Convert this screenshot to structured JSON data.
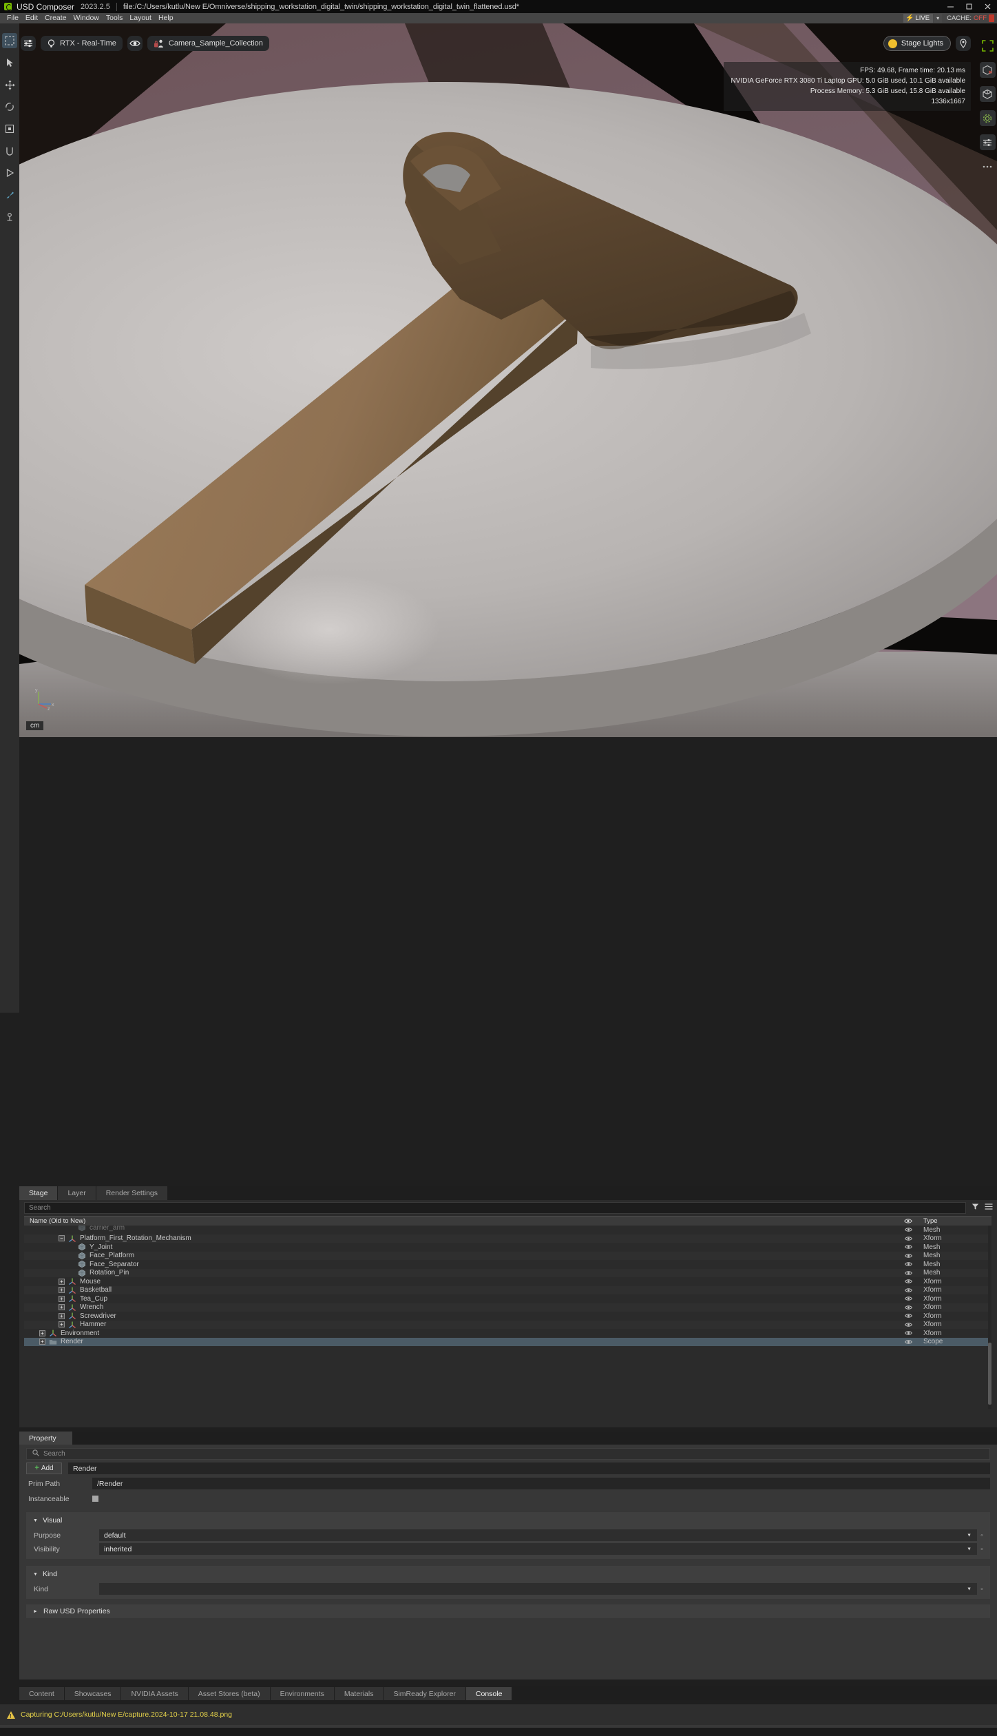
{
  "titlebar": {
    "app_name": "USD Composer",
    "version": "2023.2.5",
    "file_path": "file:/C:/Users/kutlu/New E/Omniverse/shipping_workstation_digital_twin/shipping_workstation_digital_twin_flattened.usd*",
    "minimize": "—",
    "maximize": "□",
    "close": "✕"
  },
  "menubar": {
    "items": [
      "File",
      "Edit",
      "Create",
      "Window",
      "Tools",
      "Layout",
      "Help"
    ]
  },
  "live_strip": {
    "live_label": "LIVE",
    "bolt": "⚡",
    "caret": "▾",
    "cache_label": "CACHE:",
    "cache_value": "OFF"
  },
  "left_toolbar": {
    "items": [
      {
        "name": "select-mode-icon",
        "selected": true
      },
      {
        "name": "cursor-select-icon",
        "selected": false
      },
      {
        "name": "move-tool-icon",
        "selected": false
      },
      {
        "name": "rotate-tool-icon",
        "selected": false
      },
      {
        "name": "scale-tool-icon",
        "selected": false
      },
      {
        "name": "snap-tool-icon",
        "selected": false
      },
      {
        "name": "play-animation-icon",
        "selected": false
      },
      {
        "name": "paint-tool-icon",
        "selected": false
      },
      {
        "name": "physics-tool-icon",
        "selected": false
      }
    ]
  },
  "viewport_toolbar": {
    "settings_icon": "sliders-icon",
    "renderer_label": "RTX - Real-Time",
    "renderer_icon": "lightbulb-icon",
    "eye_icon": "eye-icon",
    "camera_label": "Camera_Sample_Collection",
    "camera_icon": "camera-lock-icon",
    "stage_lights_label": "Stage Lights",
    "stage_lights_icon": "lightbulb-filled-icon",
    "pin_icon": "location-pin-icon"
  },
  "hud": {
    "line1": "FPS: 49.68, Frame time: 20.13 ms",
    "line2": "NVIDIA GeForce RTX 3080 Ti Laptop GPU: 5.0 GiB used, 10.1 GiB available",
    "line3": "Process Memory: 5.3 GiB used, 15.8 GiB available",
    "line4": "1336x1667"
  },
  "viewport": {
    "unit_badge": "cm",
    "axis_x_label": "x",
    "axis_y_label": "y",
    "axis_z_label": "z"
  },
  "right_toolbar": {
    "items": [
      {
        "name": "viewport-expand-icon"
      },
      {
        "name": "cube-delete-icon"
      },
      {
        "name": "cube-add-icon"
      },
      {
        "name": "settings-gear-icon"
      },
      {
        "name": "sliders-adjust-icon"
      },
      {
        "name": "options-dots-icon"
      }
    ]
  },
  "stage_panel": {
    "tabs": [
      {
        "label": "Stage",
        "active": true
      },
      {
        "label": "Layer",
        "active": false
      },
      {
        "label": "Render Settings",
        "active": false
      }
    ],
    "search_placeholder": "Search",
    "filter_icon": "funnel-icon",
    "options_icon": "hamburger-icon",
    "columns": {
      "name": "Name (Old to New)",
      "eye": "",
      "type": "Type"
    },
    "rows": [
      {
        "label": "carrier_arm",
        "type": "Mesh",
        "indent": 4,
        "icon": "mesh",
        "expander": "none",
        "clipped": true,
        "selected": false
      },
      {
        "label": "Platform_First_Rotation_Mechanism",
        "type": "Xform",
        "indent": 3,
        "icon": "xform",
        "expander": "minus",
        "selected": false
      },
      {
        "label": "Y_Joint",
        "type": "Mesh",
        "indent": 4,
        "icon": "mesh",
        "expander": "none",
        "selected": false
      },
      {
        "label": "Face_Platform",
        "type": "Mesh",
        "indent": 4,
        "icon": "mesh",
        "expander": "none",
        "selected": false
      },
      {
        "label": "Face_Separator",
        "type": "Mesh",
        "indent": 4,
        "icon": "mesh",
        "expander": "none",
        "selected": false
      },
      {
        "label": "Rotation_Pin",
        "type": "Mesh",
        "indent": 4,
        "icon": "mesh",
        "expander": "none",
        "selected": false
      },
      {
        "label": "Mouse",
        "type": "Xform",
        "indent": 3,
        "icon": "xform",
        "expander": "plus",
        "selected": false
      },
      {
        "label": "Basketball",
        "type": "Xform",
        "indent": 3,
        "icon": "xform",
        "expander": "plus",
        "selected": false
      },
      {
        "label": "Tea_Cup",
        "type": "Xform",
        "indent": 3,
        "icon": "xform",
        "expander": "plus",
        "selected": false
      },
      {
        "label": "Wrench",
        "type": "Xform",
        "indent": 3,
        "icon": "xform",
        "expander": "plus",
        "selected": false
      },
      {
        "label": "Screwdriver",
        "type": "Xform",
        "indent": 3,
        "icon": "xform",
        "expander": "plus",
        "selected": false
      },
      {
        "label": "Hammer",
        "type": "Xform",
        "indent": 3,
        "icon": "xform",
        "expander": "plus",
        "selected": false
      },
      {
        "label": "Environment",
        "type": "Xform",
        "indent": 1,
        "icon": "xform",
        "expander": "plus",
        "selected": false
      },
      {
        "label": "Render",
        "type": "Scope",
        "indent": 1,
        "icon": "scope",
        "expander": "plus",
        "selected": true
      }
    ]
  },
  "property_panel": {
    "tab_label": "Property",
    "search_placeholder": "Search",
    "search_icon": "search-icon",
    "add_button": "Add",
    "prim_name_value": "Render",
    "prim_path_label": "Prim Path",
    "prim_path_value": "/Render",
    "instanceable_label": "Instanceable",
    "instanceable_checked": false,
    "sections": [
      {
        "title": "Visual",
        "expanded": true,
        "rows": [
          {
            "label": "Purpose",
            "value": "default",
            "type": "combo"
          },
          {
            "label": "Visibility",
            "value": "inherited",
            "type": "combo"
          }
        ]
      },
      {
        "title": "Kind",
        "expanded": true,
        "rows": [
          {
            "label": "Kind",
            "value": "",
            "type": "combo"
          }
        ]
      }
    ],
    "raw_usd_label": "Raw USD Properties",
    "raw_usd_expanded": false
  },
  "bottom_tabs": {
    "items": [
      {
        "label": "Content",
        "active": false
      },
      {
        "label": "Showcases",
        "active": false
      },
      {
        "label": "NVIDIA Assets",
        "active": false
      },
      {
        "label": "Asset Stores (beta)",
        "active": false
      },
      {
        "label": "Environments",
        "active": false
      },
      {
        "label": "Materials",
        "active": false
      },
      {
        "label": "SimReady Explorer",
        "active": false
      },
      {
        "label": "Console",
        "active": true
      }
    ]
  },
  "status_bar": {
    "icon": "warning-icon",
    "message": "Capturing C:/Users/kutlu/New E/capture.2024-10-17 21.08.48.png"
  },
  "colors": {
    "accent_green": "#76b900",
    "warning_yellow": "#e3d14a",
    "cache_red": "#e0534a",
    "selection_blue": "#4b5b66"
  }
}
